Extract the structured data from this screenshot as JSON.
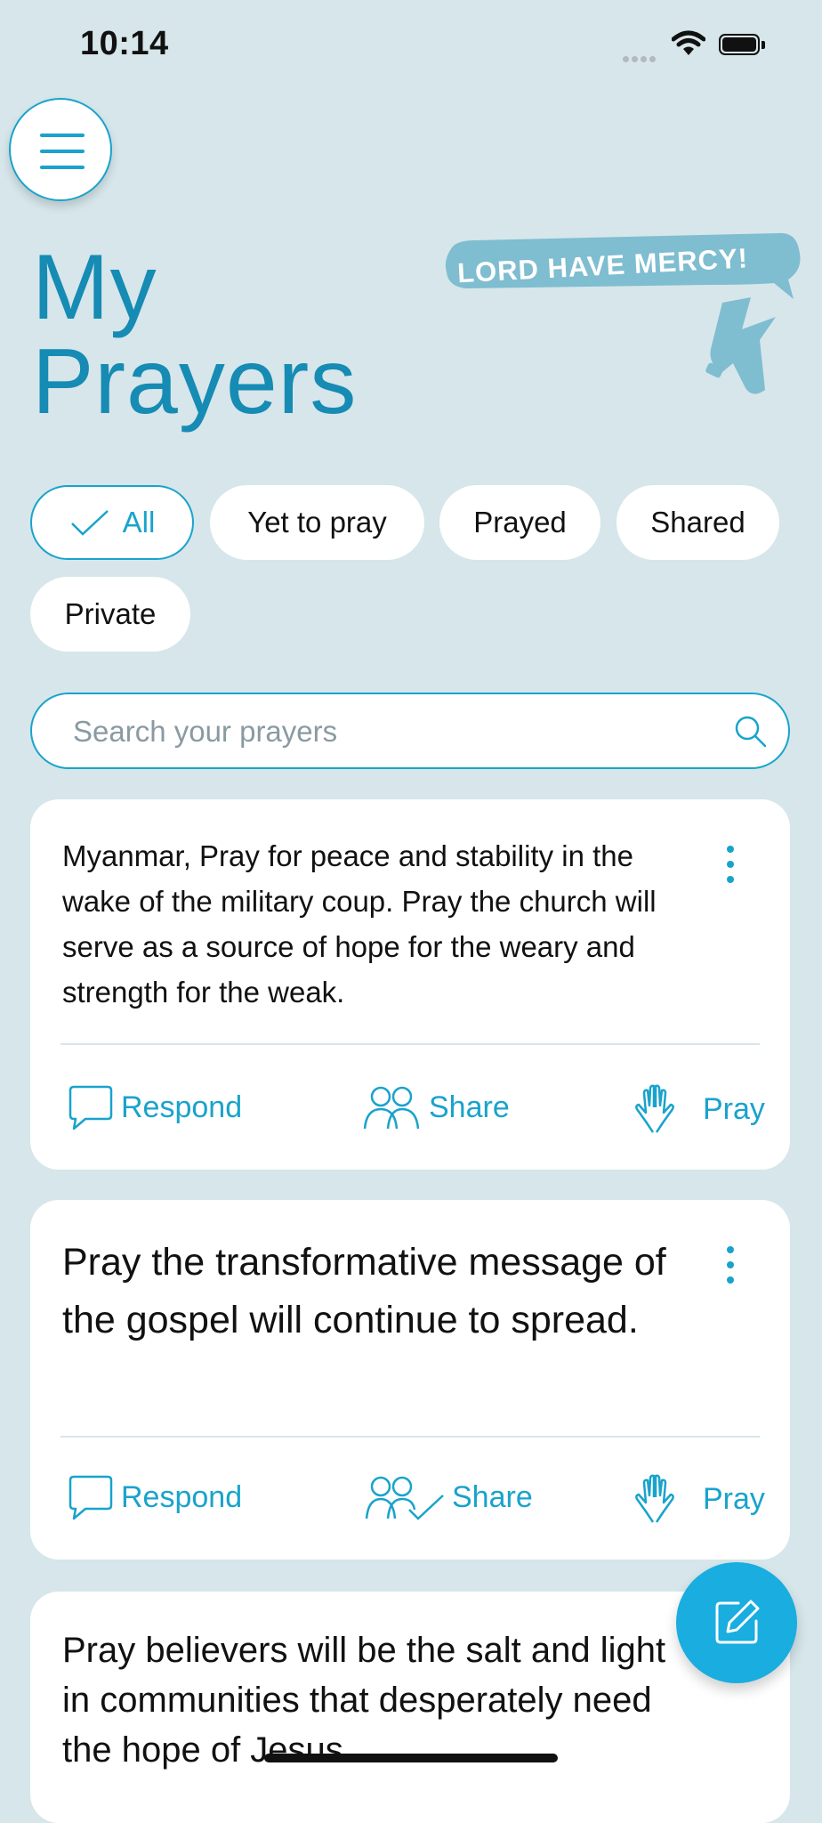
{
  "status_bar": {
    "time": "10:14"
  },
  "page": {
    "title_line1": "My",
    "title_line2": "Prayers"
  },
  "sticker": {
    "text": "LORD HAVE MERCY!"
  },
  "filters": [
    {
      "label": "All",
      "active": true
    },
    {
      "label": "Yet to pray",
      "active": false
    },
    {
      "label": "Prayed",
      "active": false
    },
    {
      "label": "Shared",
      "active": false
    },
    {
      "label": "Private",
      "active": false
    }
  ],
  "search": {
    "placeholder": "Search your prayers",
    "value": ""
  },
  "prayers": [
    {
      "text": "Myanmar, Pray for peace and stability in the wake of the military coup. Pray the church will serve as a source of hope for the weary and strength for the weak.",
      "actions": {
        "respond": "Respond",
        "share": "Share",
        "pray": "Pray"
      }
    },
    {
      "text": "Pray the transformative message of the gospel will continue to spread.",
      "actions": {
        "respond": "Respond",
        "share": "Share",
        "pray": "Pray"
      }
    },
    {
      "text": "Pray believers will be the salt and light in communities that desperately need the hope of Jesus."
    }
  ],
  "colors": {
    "accent": "#19a3cc",
    "title": "#168bb4",
    "background": "#d6e6ea",
    "fab": "#19ade0"
  },
  "icons": [
    "menu-icon",
    "check-icon",
    "search-icon",
    "more-vertical-icon",
    "chat-bubble-icon",
    "people-icon",
    "people-check-icon",
    "praying-hands-icon",
    "edit-icon"
  ]
}
